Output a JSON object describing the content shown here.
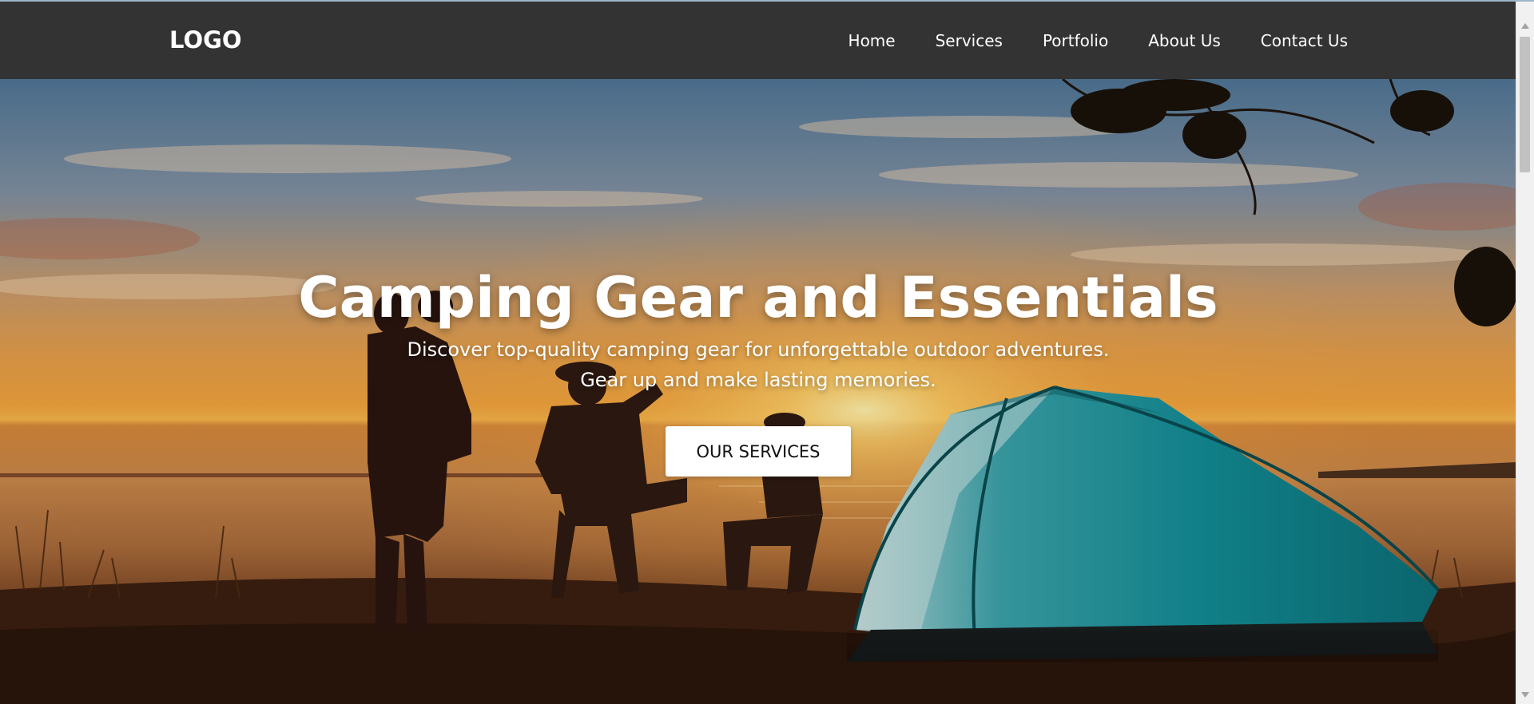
{
  "header": {
    "logo": "LOGO",
    "nav": [
      {
        "label": "Home"
      },
      {
        "label": "Services"
      },
      {
        "label": "Portfolio"
      },
      {
        "label": "About Us"
      },
      {
        "label": "Contact Us"
      }
    ]
  },
  "hero": {
    "title": "Camping Gear and Essentials",
    "subtitle_line1": "Discover top-quality camping gear for unforgettable outdoor adventures.",
    "subtitle_line2": "Gear up and make lasting memories.",
    "cta_label": "OUR SERVICES"
  },
  "colors": {
    "navbar_bg": "#333333",
    "text": "#ffffff",
    "cta_bg": "#ffffff",
    "cta_text": "#111111",
    "tent": "#1a8f96"
  }
}
